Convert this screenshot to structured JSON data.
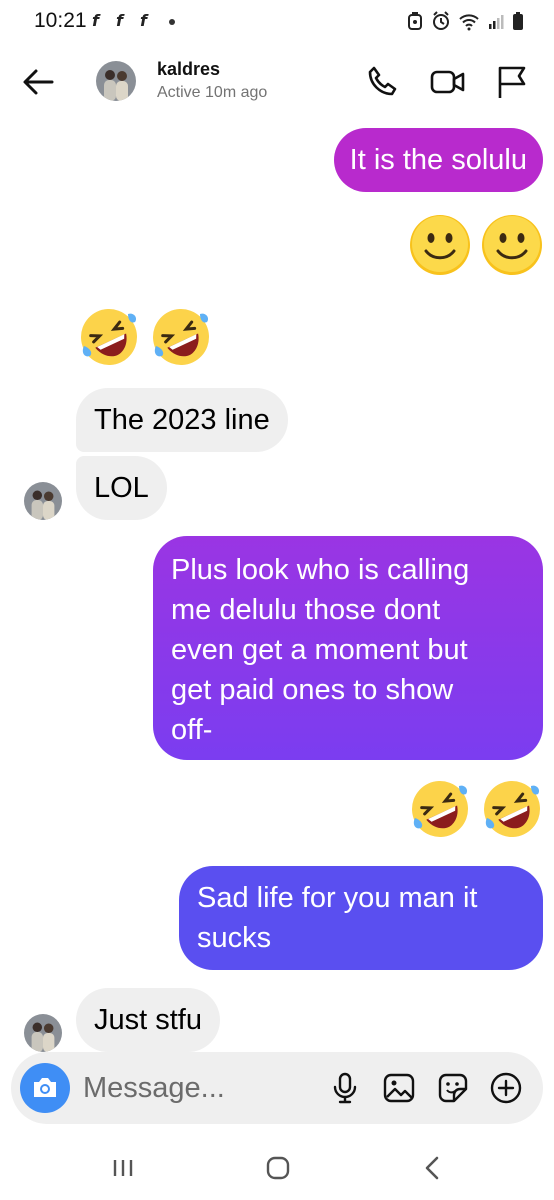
{
  "status_bar": {
    "time": "10:21",
    "notification_glyph": "f",
    "icons": [
      "alarm-icon",
      "clock-icon",
      "wifi-icon",
      "signal-icon",
      "battery-icon"
    ]
  },
  "header": {
    "contact_name": "kaldres",
    "contact_status": "Active 10m ago",
    "actions": [
      "phone-icon",
      "video-camera-icon",
      "flag-icon"
    ]
  },
  "colors": {
    "outgoing_top": "#b82acd",
    "outgoing_mid": "#7b3df0",
    "outgoing_bottom": "#5a4ff0",
    "incoming": "#efefef",
    "camera_button": "#3f8ef5"
  },
  "messages": [
    {
      "direction": "outgoing",
      "text": "It is the solulu"
    },
    {
      "direction": "outgoing",
      "emoji": [
        "slightly-smiling-face",
        "slightly-smiling-face"
      ]
    },
    {
      "direction": "incoming",
      "emoji": [
        "rolling-on-floor-laughing",
        "rolling-on-floor-laughing"
      ]
    },
    {
      "direction": "incoming",
      "text": "The 2023 line"
    },
    {
      "direction": "incoming",
      "text": "LOL"
    },
    {
      "direction": "outgoing",
      "lines": [
        "Plus look who is calling",
        "me delulu those dont",
        "even get a moment but",
        "get paid ones to show",
        "off-"
      ]
    },
    {
      "direction": "outgoing",
      "emoji": [
        "rolling-on-floor-laughing",
        "rolling-on-floor-laughing"
      ]
    },
    {
      "direction": "outgoing",
      "lines": [
        "Sad life for you man it",
        "sucks"
      ]
    },
    {
      "direction": "incoming",
      "text": "Just stfu"
    }
  ],
  "composer": {
    "placeholder": "Message...",
    "buttons": [
      "camera-icon",
      "microphone-icon",
      "gallery-icon",
      "sticker-icon",
      "plus-circle-icon"
    ]
  },
  "nav": [
    "recent-apps-icon",
    "home-icon",
    "back-icon"
  ]
}
